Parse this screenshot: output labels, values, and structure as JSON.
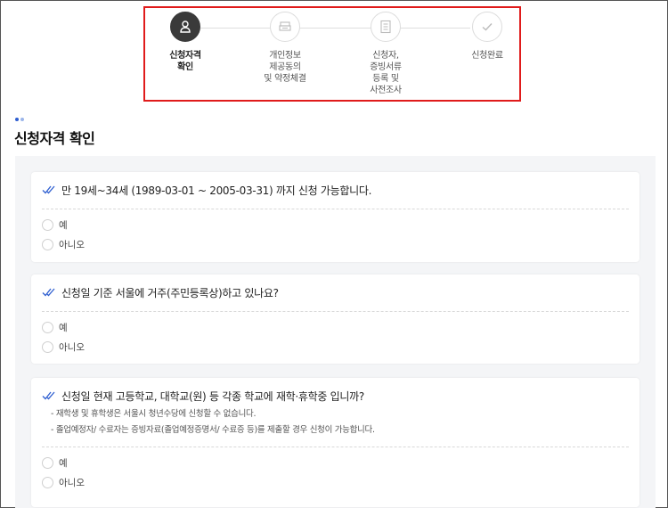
{
  "stepper": {
    "steps": [
      {
        "label": "신청자격\n확인",
        "icon": "person-icon",
        "active": true
      },
      {
        "label": "개인정보\n제공동의\n및 약정체결",
        "icon": "document-stack-icon",
        "active": false
      },
      {
        "label": "신청자,\n증빙서류\n등록 및\n사전조사",
        "icon": "clipboard-list-icon",
        "active": false
      },
      {
        "label": "신청완료",
        "icon": "check-icon",
        "active": false
      }
    ]
  },
  "section": {
    "title": "신청자격 확인"
  },
  "questions": [
    {
      "text": "만 19세~34세 (1989-03-01 ~ 2005-03-31) 까지 신청 가능합니다.",
      "options": [
        "예",
        "아니오"
      ],
      "notes": []
    },
    {
      "text": "신청일 기준 서울에 거주(주민등록상)하고 있나요?",
      "options": [
        "예",
        "아니오"
      ],
      "notes": []
    },
    {
      "text": "신청일 현재 고등학교, 대학교(원) 등 각종 학교에 재학·휴학중 입니까?",
      "options": [
        "예",
        "아니오"
      ],
      "notes": [
        "- 재학생 및 휴학생은 서울시 청년수당에 신청할 수 없습니다.",
        "- 졸업예정자/ 수료자는 증빙자료(졸업예정증명서/ 수료증 등)를 제출할 경우 신청이 가능합니다."
      ]
    }
  ],
  "colors": {
    "active_step": "#3a3a3a",
    "highlight_border": "#e01b1b",
    "check_accent": "#2f5fd0",
    "title_dot_1": "#2f5fd0",
    "title_dot_2": "#9bb5ea",
    "panel_bg": "#f4f5f7"
  }
}
